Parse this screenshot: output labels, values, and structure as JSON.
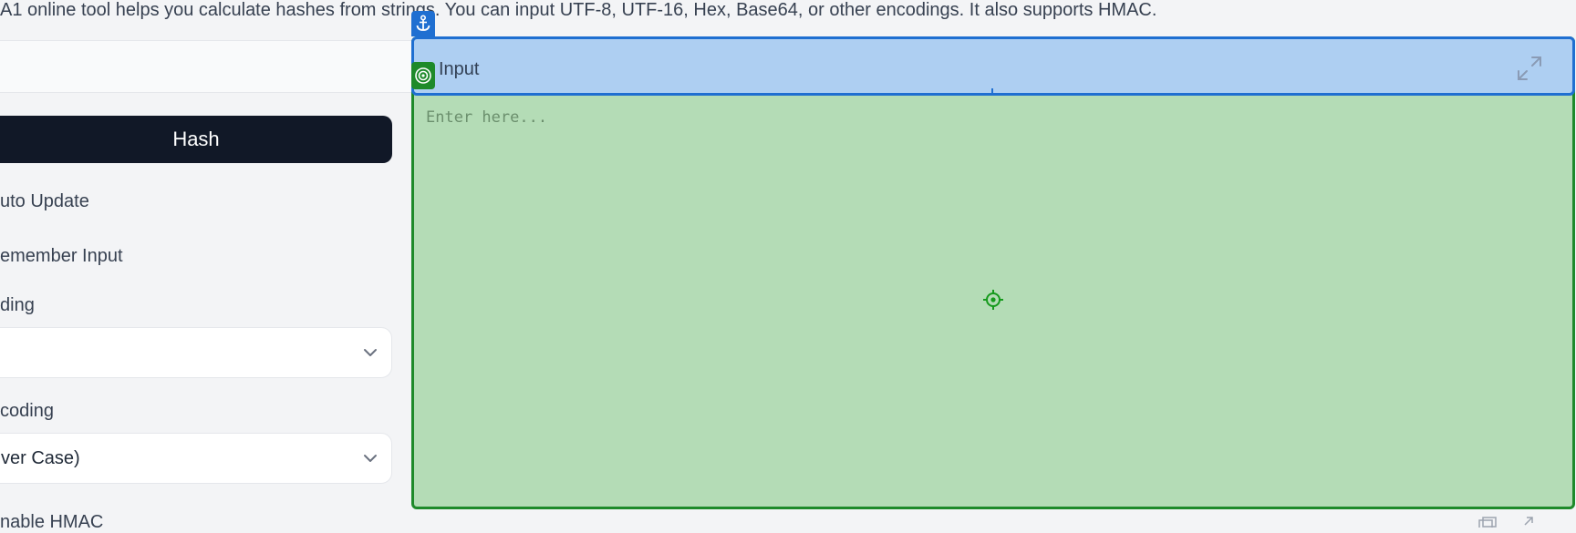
{
  "intro": {
    "text": "A1 online tool helps you calculate hashes from strings. You can input UTF-8, UTF-16, Hex, Base64, or other encodings. It also supports HMAC."
  },
  "sidebar": {
    "hash_button": "Hash",
    "auto_update": "uto Update",
    "remember_input": "emember Input",
    "input_encoding_label": "ding",
    "input_encoding_value": "",
    "output_encoding_label": "coding",
    "output_encoding_value": "ver Case)",
    "enable_hmac": "nable HMAC"
  },
  "panel": {
    "title": "Input",
    "placeholder": "Enter here...",
    "value": ""
  },
  "overlay": {
    "anchor_icon": "anchor-icon",
    "target_icon": "target-icon",
    "crosshair_icon": "crosshair-icon",
    "header_color": "#aecff2",
    "body_color": "#b4dcb6"
  }
}
